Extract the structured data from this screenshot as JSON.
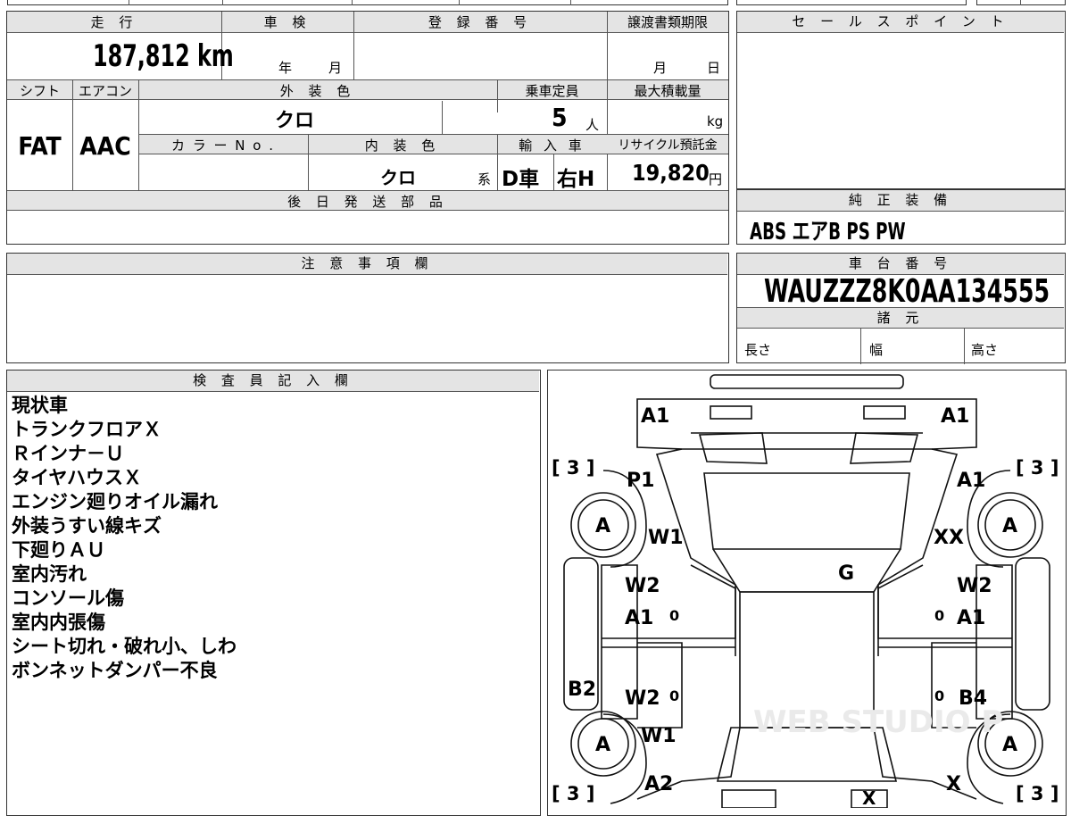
{
  "top_left": {
    "headers": {
      "mileage": "走 行",
      "inspection": "車 検",
      "registration": "登 録 番 号",
      "transfer_deadline": "譲渡書類期限",
      "shift": "シフト",
      "aircon": "エアコン",
      "exterior_color": "外 装 色",
      "capacity": "乗車定員",
      "max_load": "最大積載量",
      "color_no": "カ ラ ー N o .",
      "interior_color": "内 装 色",
      "import": "輸 入 車",
      "recycle": "リサイクル預託金"
    },
    "values": {
      "mileage": "187,812",
      "mileage_unit": "km",
      "inspection_year": "年",
      "inspection_month": "月",
      "transfer_month": "月",
      "transfer_day": "日",
      "shift": "FAT",
      "aircon": "AAC",
      "exterior_color": "クロ",
      "capacity": "5",
      "capacity_unit": "人",
      "max_load_unit": "kg",
      "interior_color": "クロ",
      "interior_suffix": "系",
      "import_dealer": "D車",
      "import_handle": "右H",
      "recycle": "19,820",
      "recycle_unit": "円"
    }
  },
  "later_parts": {
    "header": "後 日 発 送 部 品",
    "value": ""
  },
  "sales_point": {
    "header": "セ ー ル ス ポ イ ン ト",
    "value": ""
  },
  "equipment": {
    "header": "純 正 装 備",
    "value": "ABS エアB PS PW"
  },
  "notes_field": {
    "header": "注 意 事 項 欄",
    "value": ""
  },
  "chassis": {
    "header": "車 台 番 号",
    "value": "WAUZZZ8K0AA134555"
  },
  "specs": {
    "header": "諸 元",
    "length": "長さ",
    "width": "幅",
    "height": "高さ"
  },
  "inspector": {
    "header": "検 査 員 記 入 欄",
    "lines": [
      "現状車",
      "トランクフロアＸ",
      "Ｒインナ－Ｕ",
      "タイヤハウスＸ",
      "エンジン廻りオイル漏れ",
      "外装うすい線キズ",
      "下廻りＡＵ",
      "室内汚れ",
      "コンソール傷",
      "室内内張傷",
      "シート切れ・破れ小、しわ",
      "ボンネットダンパー不良"
    ]
  },
  "diagram": {
    "labels": {
      "front_left": "A1",
      "front_right": "A1",
      "fl_fender": "P1",
      "fr_fender": "A1",
      "fl_wheel_mark": "W1",
      "fr_wheel_mark": "XX",
      "hood": "G",
      "fl_door_1": "W2",
      "fl_door_2": "A1",
      "fr_door_1": "W2",
      "fr_door_2": "A1",
      "left_sill": "B2",
      "right_sill": "B4",
      "rl_door": "W2",
      "rl_wheel_mark": "W1",
      "rl_quarter": "A2",
      "rr_quarter": "X",
      "rear": "X",
      "tire": "A",
      "tire_bracket": "[ 3 ]",
      "zero": "0",
      "watermark": "WEB STUDIO P"
    }
  }
}
